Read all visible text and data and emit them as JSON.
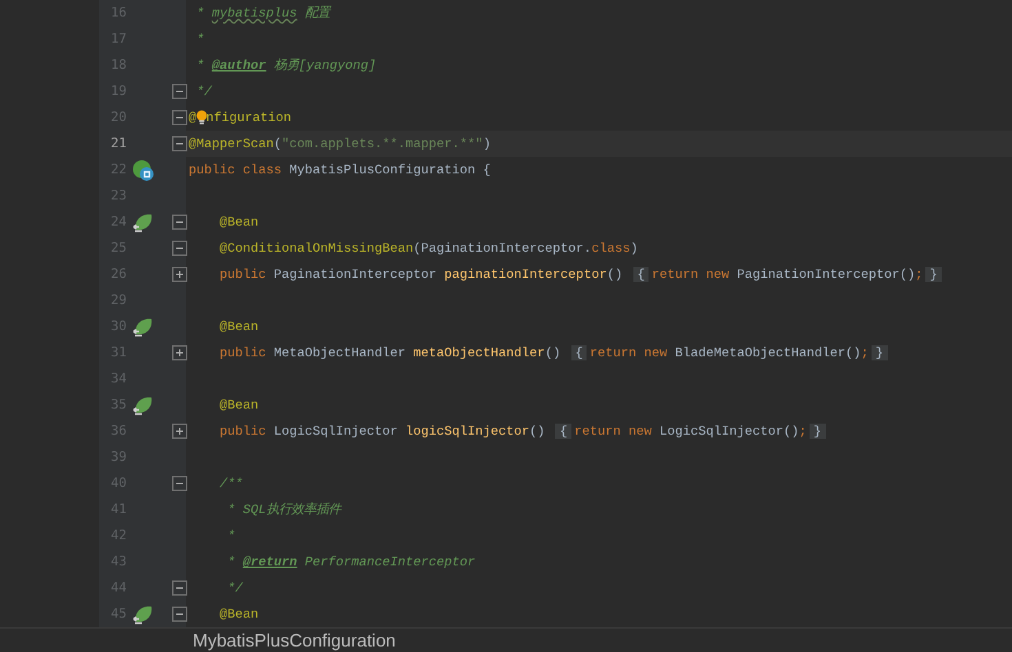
{
  "editor": {
    "lines": [
      {
        "number": "16",
        "current": false,
        "tokens": [
          {
            "text": " * ",
            "kind": "doc"
          },
          {
            "text": "mybatisplus",
            "kind": "typo"
          },
          {
            "text": " 配置",
            "kind": "doc"
          }
        ]
      },
      {
        "number": "17",
        "current": false,
        "tokens": [
          {
            "text": " *",
            "kind": "doc"
          }
        ]
      },
      {
        "number": "18",
        "current": false,
        "tokens": [
          {
            "text": " * ",
            "kind": "doc"
          },
          {
            "text": "@author",
            "kind": "doctag"
          },
          {
            "text": " 杨勇[yangyong]",
            "kind": "doc"
          }
        ]
      },
      {
        "number": "19",
        "current": false,
        "fold_marker": {
          "kind": "end"
        },
        "tokens": [
          {
            "text": " */",
            "kind": "doc"
          }
        ]
      },
      {
        "number": "20",
        "current": false,
        "fold_marker": {
          "kind": "start"
        },
        "tokens": [
          {
            "text": "@",
            "kind": "annotation"
          },
          {
            "kind": "bulb"
          },
          {
            "text": "nfiguration",
            "kind": "annotation"
          }
        ]
      },
      {
        "number": "21",
        "current": true,
        "fold_marker": {
          "kind": "start"
        },
        "tokens": [
          {
            "text": "@MapperScan",
            "kind": "annotation"
          },
          {
            "text": "(",
            "kind": "plain"
          },
          {
            "text": "\"com.applets.**.mapper.**\"",
            "kind": "string"
          },
          {
            "text": ")",
            "kind": "plain"
          }
        ]
      },
      {
        "number": "22",
        "current": false,
        "gutter_icon": {
          "kind": "class"
        },
        "tokens": [
          {
            "text": "public class ",
            "kind": "keyword"
          },
          {
            "text": "MybatisPlusConfiguration {",
            "kind": "plain"
          }
        ]
      },
      {
        "number": "23",
        "current": false
      },
      {
        "number": "24",
        "current": false,
        "gutter_icon": {
          "kind": "bean"
        },
        "fold_marker": {
          "kind": "start"
        },
        "tokens": [
          {
            "text": "    @Bean",
            "kind": "annotation"
          }
        ]
      },
      {
        "number": "25",
        "current": false,
        "fold_marker": {
          "kind": "start"
        },
        "tokens": [
          {
            "text": "    @ConditionalOnMissingBean",
            "kind": "annotation"
          },
          {
            "text": "(PaginationInterceptor.",
            "kind": "plain"
          },
          {
            "text": "class",
            "kind": "keyword"
          },
          {
            "text": ")",
            "kind": "plain"
          }
        ]
      },
      {
        "number": "26",
        "current": false,
        "fold_marker": {
          "kind": "collapsed"
        },
        "tokens": [
          {
            "text": "    public ",
            "kind": "keyword"
          },
          {
            "text": "PaginationInterceptor ",
            "kind": "plain"
          },
          {
            "text": "paginationInterceptor",
            "kind": "method"
          },
          {
            "text": "() ",
            "kind": "plain"
          },
          {
            "text": "{",
            "kind": "fold"
          },
          {
            "text": "return new ",
            "kind": "keyword"
          },
          {
            "text": "PaginationInterceptor()",
            "kind": "plain"
          },
          {
            "text": ";",
            "kind": "keyword"
          },
          {
            "text": "}",
            "kind": "fold"
          }
        ]
      },
      {
        "number": "29",
        "current": false
      },
      {
        "number": "30",
        "current": false,
        "gutter_icon": {
          "kind": "bean"
        },
        "tokens": [
          {
            "text": "    @Bean",
            "kind": "annotation"
          }
        ]
      },
      {
        "number": "31",
        "current": false,
        "fold_marker": {
          "kind": "collapsed"
        },
        "tokens": [
          {
            "text": "    public ",
            "kind": "keyword"
          },
          {
            "text": "MetaObjectHandler ",
            "kind": "plain"
          },
          {
            "text": "metaObjectHandler",
            "kind": "method"
          },
          {
            "text": "() ",
            "kind": "plain"
          },
          {
            "text": "{",
            "kind": "fold"
          },
          {
            "text": "return new ",
            "kind": "keyword"
          },
          {
            "text": "BladeMetaObjectHandler()",
            "kind": "plain"
          },
          {
            "text": ";",
            "kind": "keyword"
          },
          {
            "text": "}",
            "kind": "fold"
          }
        ]
      },
      {
        "number": "34",
        "current": false
      },
      {
        "number": "35",
        "current": false,
        "gutter_icon": {
          "kind": "bean"
        },
        "tokens": [
          {
            "text": "    @Bean",
            "kind": "annotation"
          }
        ]
      },
      {
        "number": "36",
        "current": false,
        "fold_marker": {
          "kind": "collapsed"
        },
        "tokens": [
          {
            "text": "    public ",
            "kind": "keyword"
          },
          {
            "text": "LogicSqlInjector ",
            "kind": "plain"
          },
          {
            "text": "logicSqlInjector",
            "kind": "method"
          },
          {
            "text": "() ",
            "kind": "plain"
          },
          {
            "text": "{",
            "kind": "fold"
          },
          {
            "text": "return new ",
            "kind": "keyword"
          },
          {
            "text": "LogicSqlInjector()",
            "kind": "plain"
          },
          {
            "text": ";",
            "kind": "keyword"
          },
          {
            "text": "}",
            "kind": "fold"
          }
        ]
      },
      {
        "number": "39",
        "current": false
      },
      {
        "number": "40",
        "current": false,
        "fold_marker": {
          "kind": "start"
        },
        "tokens": [
          {
            "text": "    /**",
            "kind": "doc"
          }
        ]
      },
      {
        "number": "41",
        "current": false,
        "tokens": [
          {
            "text": "     * SQL执行效率插件",
            "kind": "doc"
          }
        ]
      },
      {
        "number": "42",
        "current": false,
        "tokens": [
          {
            "text": "     *",
            "kind": "doc"
          }
        ]
      },
      {
        "number": "43",
        "current": false,
        "tokens": [
          {
            "text": "     * ",
            "kind": "doc"
          },
          {
            "text": "@return",
            "kind": "doctag"
          },
          {
            "text": " PerformanceInterceptor",
            "kind": "doc"
          }
        ]
      },
      {
        "number": "44",
        "current": false,
        "fold_marker": {
          "kind": "end"
        },
        "tokens": [
          {
            "text": "     */",
            "kind": "doc"
          }
        ]
      },
      {
        "number": "45",
        "current": false,
        "gutter_icon": {
          "kind": "bean"
        },
        "fold_marker": {
          "kind": "start"
        },
        "tokens": [
          {
            "text": "    @Bean",
            "kind": "annotation"
          }
        ]
      }
    ]
  },
  "breadcrumb": "MybatisPlusConfiguration"
}
